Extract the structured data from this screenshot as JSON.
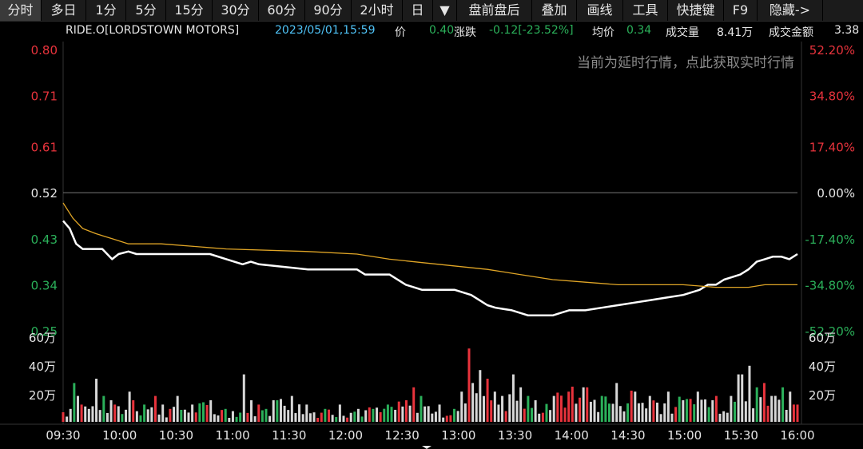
{
  "toolbar": {
    "items": [
      "分时",
      "多日",
      "1分",
      "5分",
      "15分",
      "30分",
      "60分",
      "90分",
      "2小时",
      "日",
      "▼",
      "盘前盘后",
      "叠加",
      "画线",
      "工具",
      "快捷键",
      "F9",
      "隐藏->"
    ],
    "active_index": 0
  },
  "info": {
    "symbol": "RIDE.O[LORDSTOWN MOTORS]",
    "datetime": "2023/05/01,15:59",
    "price_label": "价",
    "price": "0.40",
    "change_label": "涨跌",
    "change": "-0.12[-23.52%]",
    "avg_label": "均价",
    "avg": "0.34",
    "volume_label": "成交量",
    "volume": "8.41万",
    "amount_label": "成交金额",
    "amount": "3.38"
  },
  "notice": "当前为延时行情，点此获取实时行情",
  "colors": {
    "up": "#e8333c",
    "down": "#2bb05a",
    "neutral": "#e6e6e6",
    "avg_line": "#e0a526",
    "price_line": "#ffffff",
    "grid": "#2a2a2a",
    "date": "#4fc3f7"
  },
  "chart_data": {
    "type": "line",
    "price_ticks": [
      "0.80",
      "0.71",
      "0.61",
      "0.52",
      "0.43",
      "0.34",
      "0.25"
    ],
    "pct_ticks": [
      "52.20%",
      "34.80%",
      "17.40%",
      "0.00%",
      "-17.40%",
      "-34.80%",
      "-52.20%"
    ],
    "ref_price": 0.52,
    "ylim": [
      0.25,
      0.8
    ],
    "volume_ticks": [
      "60万",
      "40万",
      "20万"
    ],
    "volume_max": 600000,
    "time_ticks": [
      "09:30",
      "10:00",
      "10:30",
      "11:00",
      "11:30",
      "12:00",
      "12:30",
      "13:00",
      "13:30",
      "14:00",
      "14:30",
      "15:00",
      "15:30",
      "16:00"
    ],
    "series": [
      {
        "name": "price",
        "points": [
          [
            0,
            0.465
          ],
          [
            4,
            0.45
          ],
          [
            8,
            0.42
          ],
          [
            12,
            0.41
          ],
          [
            16,
            0.41
          ],
          [
            24,
            0.41
          ],
          [
            30,
            0.39
          ],
          [
            34,
            0.4
          ],
          [
            40,
            0.405
          ],
          [
            45,
            0.4
          ],
          [
            60,
            0.4
          ],
          [
            90,
            0.4
          ],
          [
            100,
            0.39
          ],
          [
            110,
            0.38
          ],
          [
            115,
            0.385
          ],
          [
            120,
            0.38
          ],
          [
            150,
            0.37
          ],
          [
            180,
            0.37
          ],
          [
            185,
            0.36
          ],
          [
            200,
            0.36
          ],
          [
            210,
            0.34
          ],
          [
            220,
            0.33
          ],
          [
            240,
            0.33
          ],
          [
            250,
            0.32
          ],
          [
            255,
            0.31
          ],
          [
            260,
            0.3
          ],
          [
            265,
            0.295
          ],
          [
            275,
            0.29
          ],
          [
            285,
            0.28
          ],
          [
            300,
            0.28
          ],
          [
            305,
            0.285
          ],
          [
            310,
            0.29
          ],
          [
            320,
            0.29
          ],
          [
            330,
            0.295
          ],
          [
            340,
            0.3
          ],
          [
            350,
            0.305
          ],
          [
            360,
            0.31
          ],
          [
            370,
            0.315
          ],
          [
            380,
            0.32
          ],
          [
            390,
            0.33
          ],
          [
            395,
            0.34
          ],
          [
            400,
            0.34
          ],
          [
            405,
            0.35
          ],
          [
            410,
            0.355
          ],
          [
            415,
            0.36
          ],
          [
            420,
            0.37
          ],
          [
            425,
            0.385
          ],
          [
            430,
            0.39
          ],
          [
            435,
            0.395
          ],
          [
            440,
            0.395
          ],
          [
            445,
            0.39
          ],
          [
            450,
            0.4
          ]
        ]
      },
      {
        "name": "avg",
        "points": [
          [
            0,
            0.5
          ],
          [
            6,
            0.47
          ],
          [
            12,
            0.45
          ],
          [
            20,
            0.44
          ],
          [
            30,
            0.43
          ],
          [
            40,
            0.42
          ],
          [
            60,
            0.42
          ],
          [
            80,
            0.415
          ],
          [
            100,
            0.41
          ],
          [
            150,
            0.405
          ],
          [
            180,
            0.4
          ],
          [
            200,
            0.39
          ],
          [
            230,
            0.38
          ],
          [
            260,
            0.37
          ],
          [
            280,
            0.36
          ],
          [
            300,
            0.35
          ],
          [
            320,
            0.345
          ],
          [
            340,
            0.34
          ],
          [
            360,
            0.34
          ],
          [
            380,
            0.34
          ],
          [
            400,
            0.335
          ],
          [
            420,
            0.335
          ],
          [
            430,
            0.34
          ],
          [
            450,
            0.34
          ]
        ]
      }
    ],
    "volume": [
      [
        4,
        0.15
      ],
      [
        6,
        0.45
      ],
      [
        10,
        0.3
      ],
      [
        12,
        0.2
      ],
      [
        20,
        0.5
      ],
      [
        24,
        0.3
      ],
      [
        30,
        0.25
      ],
      [
        32,
        0.2
      ],
      [
        40,
        0.35
      ],
      [
        44,
        0.25
      ],
      [
        50,
        0.2
      ],
      [
        56,
        0.3
      ],
      [
        60,
        0.2
      ],
      [
        66,
        0.15
      ],
      [
        70,
        0.3
      ],
      [
        80,
        0.2
      ],
      [
        90,
        0.25
      ],
      [
        100,
        0.15
      ],
      [
        110,
        0.55
      ],
      [
        115,
        0.25
      ],
      [
        120,
        0.2
      ],
      [
        125,
        0.15
      ],
      [
        130,
        0.25
      ],
      [
        140,
        0.3
      ],
      [
        150,
        0.2
      ],
      [
        160,
        0.15
      ],
      [
        170,
        0.2
      ],
      [
        180,
        0.15
      ],
      [
        190,
        0.15
      ],
      [
        200,
        0.2
      ],
      [
        210,
        0.25
      ],
      [
        215,
        0.4
      ],
      [
        220,
        0.3
      ],
      [
        230,
        0.2
      ],
      [
        240,
        0.15
      ],
      [
        245,
        0.35
      ],
      [
        248,
        0.85
      ],
      [
        252,
        0.45
      ],
      [
        256,
        0.6
      ],
      [
        260,
        0.5
      ],
      [
        264,
        0.35
      ],
      [
        270,
        0.3
      ],
      [
        275,
        0.55
      ],
      [
        280,
        0.4
      ],
      [
        285,
        0.3
      ],
      [
        290,
        0.25
      ],
      [
        300,
        0.3
      ],
      [
        310,
        0.35
      ],
      [
        320,
        0.4
      ],
      [
        330,
        0.3
      ],
      [
        340,
        0.45
      ],
      [
        350,
        0.35
      ],
      [
        360,
        0.3
      ],
      [
        370,
        0.35
      ],
      [
        380,
        0.25
      ],
      [
        390,
        0.35
      ],
      [
        400,
        0.3
      ],
      [
        410,
        0.3
      ],
      [
        415,
        0.55
      ],
      [
        420,
        0.65
      ],
      [
        425,
        0.4
      ],
      [
        430,
        0.45
      ],
      [
        435,
        0.3
      ],
      [
        440,
        0.4
      ],
      [
        445,
        0.35
      ],
      [
        450,
        0.2
      ]
    ]
  }
}
